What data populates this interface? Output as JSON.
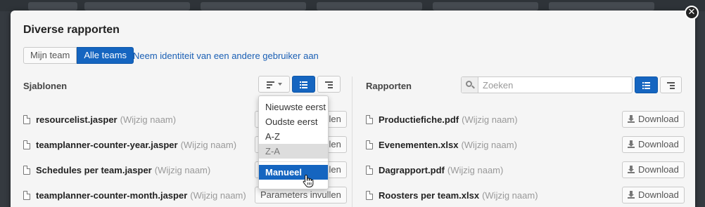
{
  "modal": {
    "title": "Diverse rapporten",
    "close_glyph": "✕"
  },
  "scope_tabs": [
    {
      "label": "Mijn team",
      "active": false
    },
    {
      "label": "Alle teams",
      "active": true
    }
  ],
  "impersonate_link": "Neem identiteit van een andere gebruiker aan",
  "templates": {
    "title": "Sjablonen",
    "rename_label": "(Wijzig naam)",
    "action_label": "Parameters invullen",
    "items": [
      {
        "name": "resourcelist.jasper"
      },
      {
        "name": "teamplanner-counter-year.jasper"
      },
      {
        "name": "Schedules per team.jasper"
      },
      {
        "name": "teamplanner-counter-month.jasper"
      }
    ]
  },
  "sort_menu": {
    "options": [
      "Nieuwste eerst",
      "Oudste eerst",
      "A-Z",
      "Z-A"
    ],
    "disabled_option": "Z-A",
    "selected_option": "Manueel"
  },
  "reports": {
    "title": "Rapporten",
    "search_placeholder": "Zoeken",
    "rename_label": "(Wijzig naam)",
    "download_label": "Download",
    "items": [
      {
        "name": "Productiefiche.pdf"
      },
      {
        "name": "Evenementen.xlsx"
      },
      {
        "name": "Dagrapport.pdf"
      },
      {
        "name": "Roosters per team.xlsx"
      }
    ]
  },
  "icons": [
    "close-icon",
    "sort-icon",
    "list-view-icon",
    "tree-view-icon",
    "search-icon",
    "file-icon",
    "download-icon",
    "hand-cursor-icon"
  ],
  "colors": {
    "accent": "#1565c0",
    "link": "#1a5fb4",
    "background": "#f5f5f5"
  }
}
